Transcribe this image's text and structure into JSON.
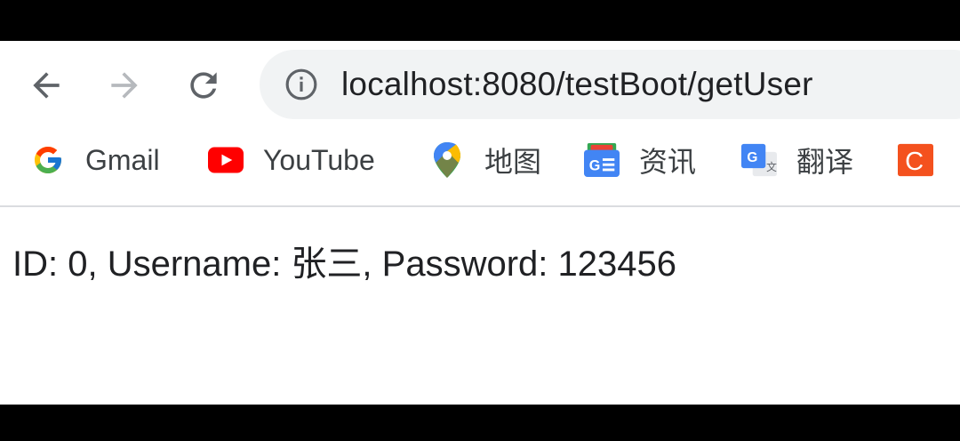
{
  "address_bar": {
    "url": "localhost:8080/testBoot/getUser"
  },
  "bookmarks": [
    {
      "label": "Gmail",
      "icon": "google-g-icon"
    },
    {
      "label": "YouTube",
      "icon": "youtube-icon"
    },
    {
      "label": "地图",
      "icon": "maps-pin-icon"
    },
    {
      "label": "资讯",
      "icon": "news-icon"
    },
    {
      "label": "翻译",
      "icon": "translate-icon"
    },
    {
      "label": "",
      "icon": "c-app-icon"
    }
  ],
  "page": {
    "text": "ID: 0, Username: 张三, Password: 123456"
  },
  "colors": {
    "omnibox_bg": "#f1f3f4",
    "youtube_red": "#ff0000",
    "news_blue": "#4285f4",
    "app_orange": "#f4511e"
  }
}
